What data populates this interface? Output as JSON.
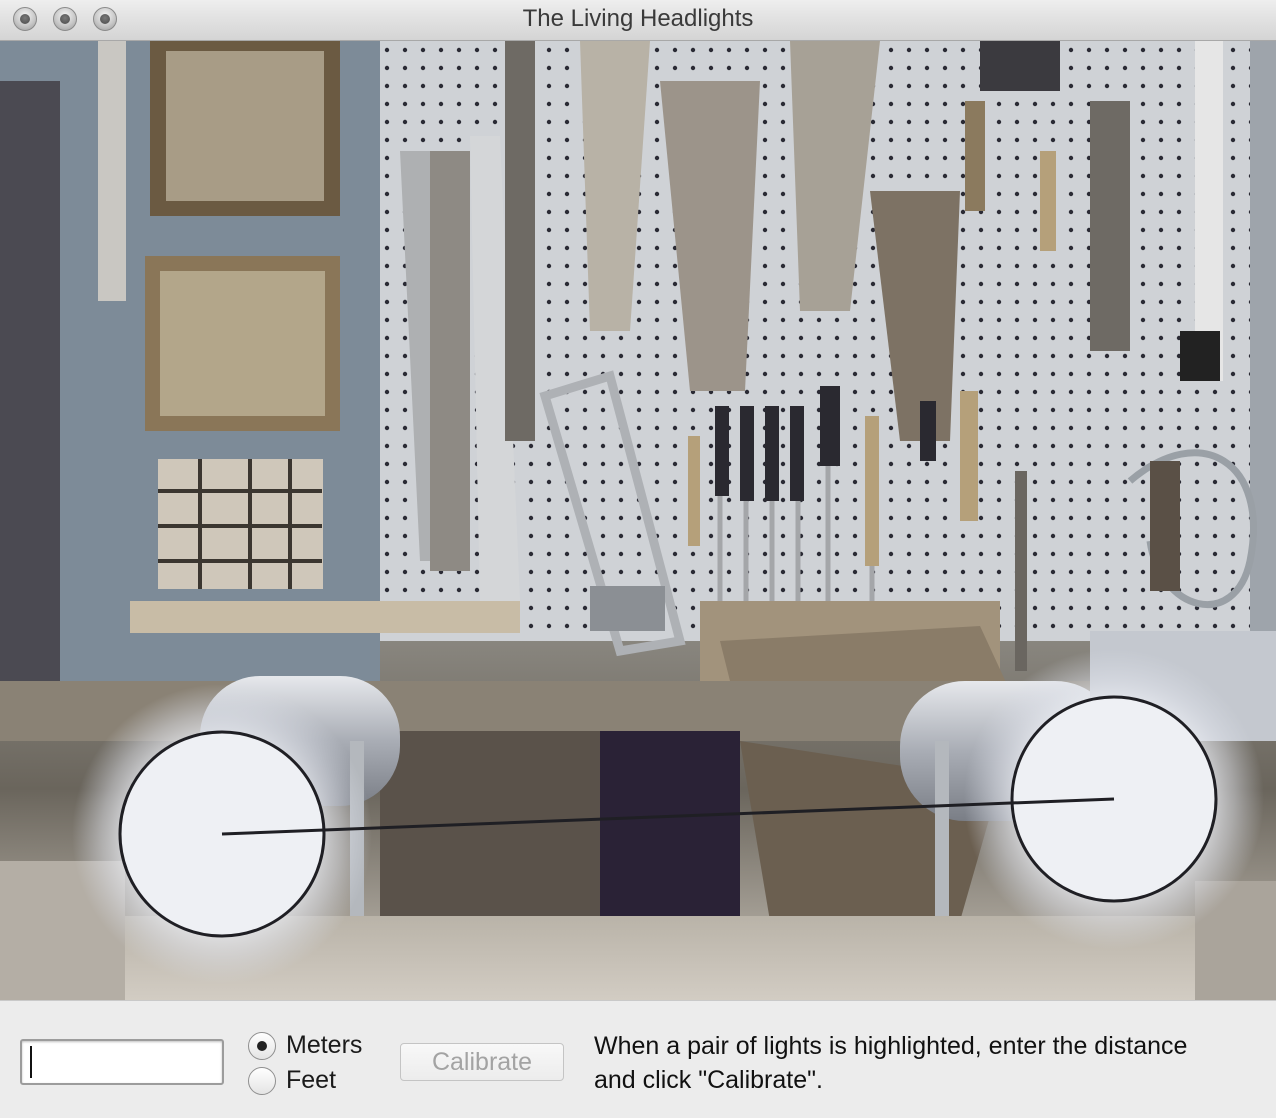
{
  "window": {
    "title": "The Living Headlights"
  },
  "controls": {
    "distance_value": "",
    "units": [
      {
        "label": "Meters",
        "selected": true
      },
      {
        "label": "Feet",
        "selected": false
      }
    ],
    "calibrate_label": "Calibrate",
    "calibrate_enabled": false,
    "instructions": "When a pair of lights is highlighted, enter the distance and click \"Calibrate\"."
  },
  "camera": {
    "highlighted_lights": [
      "left-light",
      "right-light"
    ],
    "scene": "workshop wall with pegboard of hanging tools"
  }
}
